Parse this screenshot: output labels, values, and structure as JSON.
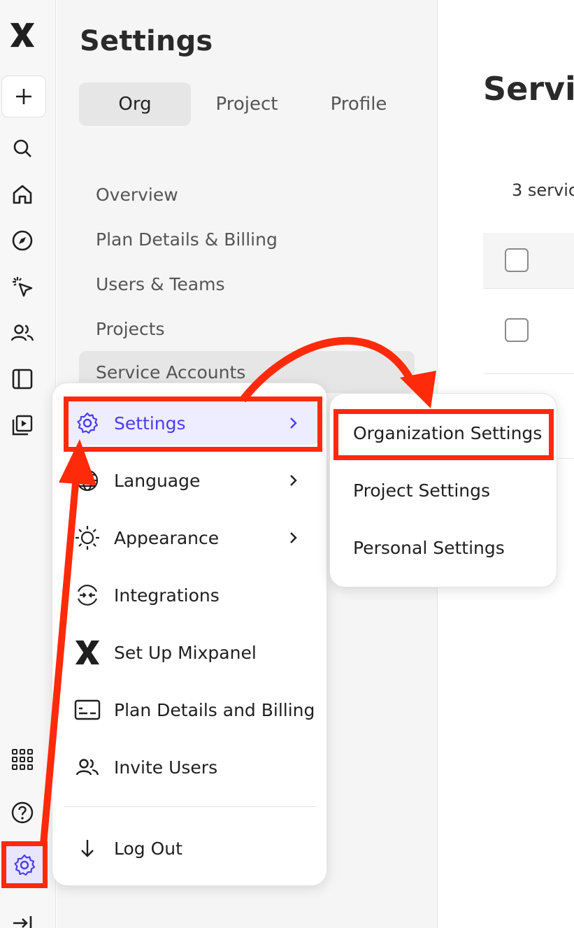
{
  "settings_panel": {
    "title": "Settings",
    "tabs": [
      "Org",
      "Project",
      "Profile"
    ],
    "nav": [
      "Overview",
      "Plan Details & Billing",
      "Users & Teams",
      "Projects",
      "Service Accounts"
    ]
  },
  "main": {
    "title_partial": "Servic",
    "count_partial": "3 servic"
  },
  "menu": {
    "items": [
      {
        "label": "Settings",
        "icon": "gear-icon",
        "has_submenu": true
      },
      {
        "label": "Language",
        "icon": "globe-icon",
        "has_submenu": true
      },
      {
        "label": "Appearance",
        "icon": "sun-icon",
        "has_submenu": true
      },
      {
        "label": "Integrations",
        "icon": "integrations-icon",
        "has_submenu": false
      },
      {
        "label": "Set Up Mixpanel",
        "icon": "mixpanel-logo-icon",
        "has_submenu": false
      },
      {
        "label": "Plan Details and Billing",
        "icon": "billing-card-icon",
        "has_submenu": false
      },
      {
        "label": "Invite Users",
        "icon": "users-icon",
        "has_submenu": false
      }
    ],
    "logout": {
      "label": "Log Out",
      "icon": "arrow-down-icon"
    }
  },
  "submenu": {
    "items": [
      "Organization Settings",
      "Project Settings",
      "Personal Settings"
    ]
  },
  "colors": {
    "accent": "#4b3cf0",
    "annotation": "#ff2a0a",
    "active_bg": "#eeedff"
  }
}
